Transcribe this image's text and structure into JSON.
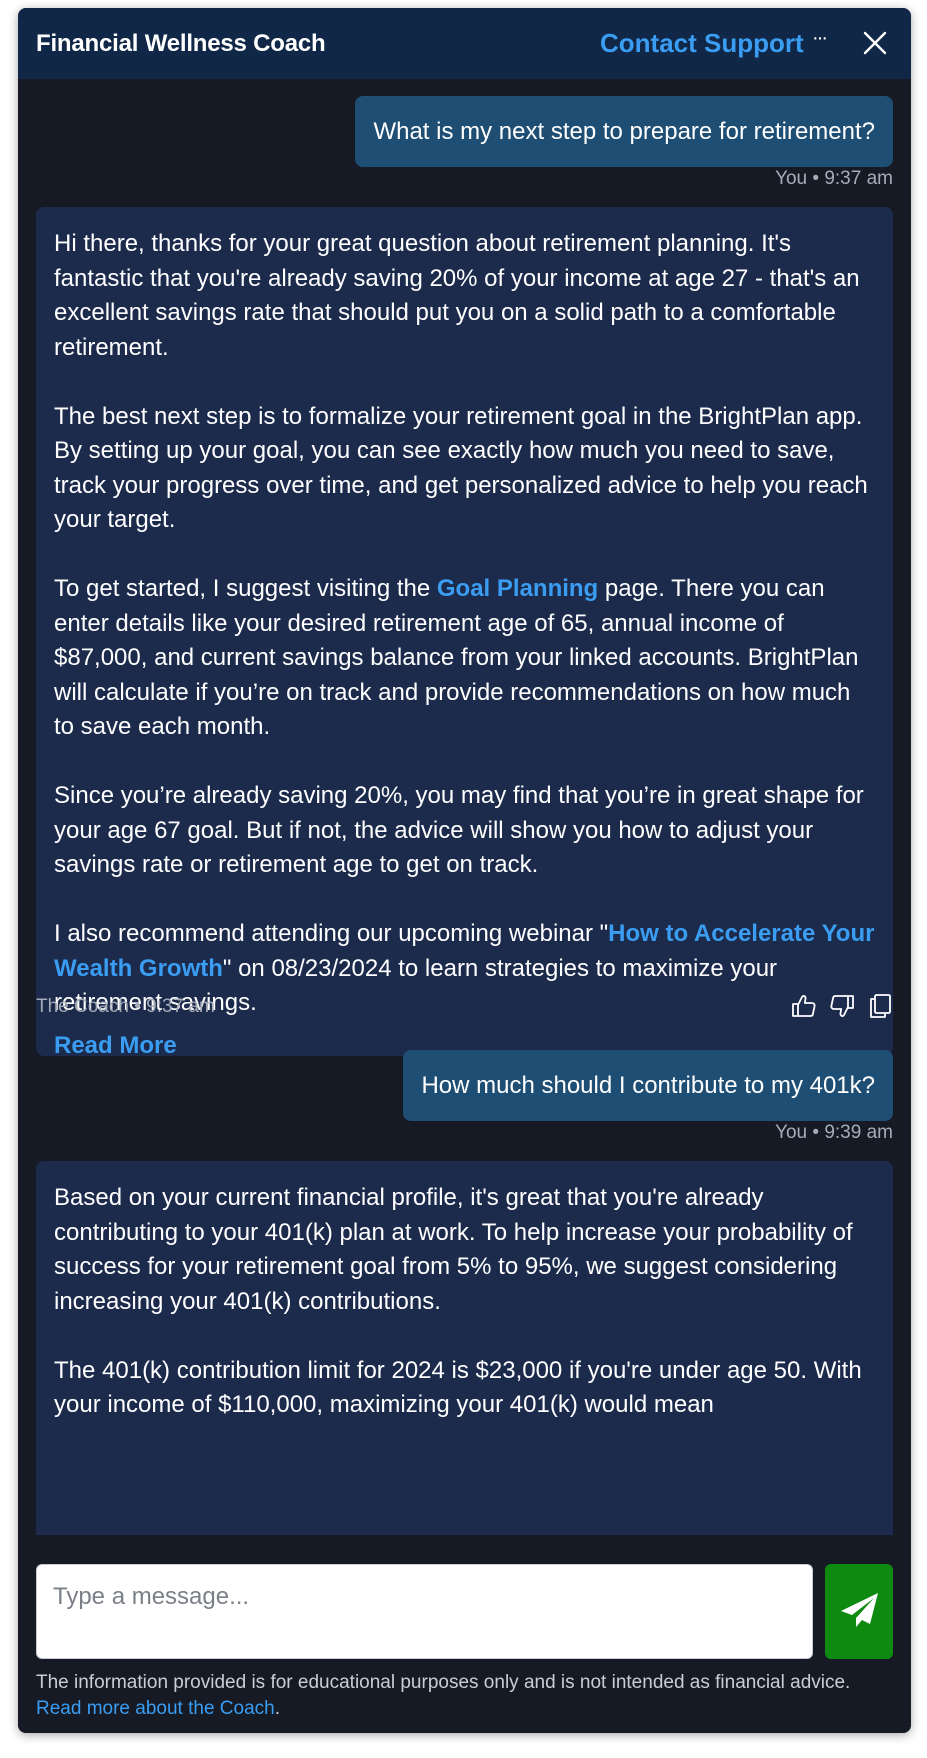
{
  "header": {
    "title": "Financial Wellness Coach",
    "contact_label": "Contact Support",
    "more_label": "···"
  },
  "messages": [
    {
      "text": "What is my next step to prepare for retirement?",
      "meta": "You • 9:37 am"
    },
    {
      "paragraphs": {
        "p1": "Hi there, thanks for your great question about retirement planning. It's fantastic that you're already saving 20% of your income at age 27 - that's an excellent savings rate that should put you on a solid path to a comfortable retirement.",
        "p2": "The best next step is to formalize your retirement goal in the BrightPlan app. By setting up your goal, you can see exactly how much you need to save, track your progress over time, and get personalized advice to help you reach your target.",
        "p3_before": "To get started, I suggest visiting the ",
        "p3_link": "Goal Planning",
        "p3_after": " page. There you can enter details like your desired retirement age of 65, annual income of $87,000, and current savings balance from your linked accounts. BrightPlan will calculate if you’re on track and provide recommendations on how much to save each month.",
        "p4": "Since you’re already saving 20%, you may find that you’re in great shape for your age 67 goal. But if not, the advice will show you how to adjust your savings rate or retirement age to get on track.",
        "p5_before": "I also recommend attending our upcoming webinar \"",
        "p5_link": "How to Accelerate Your Wealth Growth",
        "p5_after": "\" on 08/23/2024 to learn strategies to maximize your retirement savings."
      },
      "read_more": "Read More",
      "meta": "The Coach • 9:37 am"
    },
    {
      "text": "How much should I contribute to my 401k?",
      "meta": "You • 9:39 am"
    },
    {
      "paragraphs": {
        "p1": "Based on your current financial profile, it's great that you're already contributing to your 401(k) plan at work. To help increase your probability of success for your retirement goal from 5% to 95%, we suggest considering increasing your 401(k) contributions.",
        "p2": "The 401(k) contribution limit for 2024 is $23,000 if you're under age 50. With your income of $110,000, maximizing your 401(k) would mean"
      }
    }
  ],
  "composer": {
    "placeholder": "Type a message...",
    "send_label": "Send"
  },
  "disclaimer": {
    "text": "The information provided is for educational purposes only and is not intended as financial advice.",
    "link": "Read more about the Coach",
    "period": "."
  },
  "colors": {
    "header_bg": "#102747",
    "user_bubble": "#1f4e74",
    "coach_bubble": "#1c2a4c",
    "link": "#3a9df2",
    "send_button": "#0f8a11"
  }
}
